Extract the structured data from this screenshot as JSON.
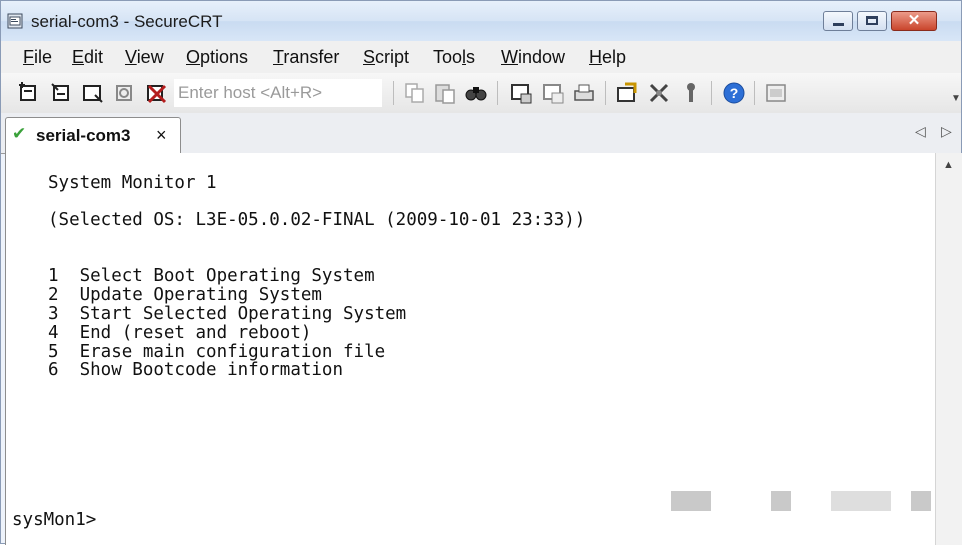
{
  "window": {
    "title": "serial-com3 - SecureCRT",
    "close_glyph": "✕"
  },
  "menu": [
    {
      "pre": "",
      "u": "F",
      "post": "ile"
    },
    {
      "pre": "",
      "u": "E",
      "post": "dit"
    },
    {
      "pre": "",
      "u": "V",
      "post": "iew"
    },
    {
      "pre": "",
      "u": "O",
      "post": "ptions"
    },
    {
      "pre": "",
      "u": "T",
      "post": "ransfer"
    },
    {
      "pre": "",
      "u": "S",
      "post": "cript"
    },
    {
      "pre": "Too",
      "u": "l",
      "post": "s"
    },
    {
      "pre": "",
      "u": "W",
      "post": "indow"
    },
    {
      "pre": "",
      "u": "H",
      "post": "elp"
    }
  ],
  "toolbar": {
    "host_placeholder": "Enter host <Alt+R>"
  },
  "tabs": [
    {
      "label": "serial-com3",
      "close": "×",
      "status_icon": "check-icon"
    }
  ],
  "tab_nav": {
    "prev": "◁",
    "next": "▷"
  },
  "terminal": {
    "lines": [
      "System Monitor 1",
      "(Selected OS: L3E-05.0.02-FINAL (2009-10-01 23:33))",
      "1  Select Boot Operating System",
      "2  Update Operating System",
      "3  Start Selected Operating System",
      "4  End (reset and reboot)",
      "5  Erase main configuration file",
      "6  Show Bootcode information"
    ],
    "prompt": "sysMon1>"
  },
  "colors": {
    "tab_check": "#3aa13a",
    "close_button": "#c9452c"
  }
}
